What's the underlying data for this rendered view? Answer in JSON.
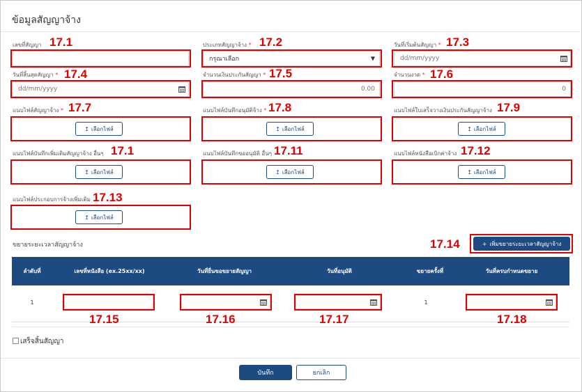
{
  "modal": {
    "title": "ข้อมูลสัญญาจ้าง",
    "required_mark": "*"
  },
  "fields": {
    "contract_no": {
      "label": "เลขที่สัญญา",
      "value": "",
      "annotation": "17.1"
    },
    "contract_type": {
      "label": "ประเภทสัญญาจ้าง",
      "selected": "กรุณาเลือก",
      "annotation": "17.2"
    },
    "start_date": {
      "label": "วันที่เริ่มต้นสัญญา",
      "placeholder": "dd/mm/yyyy",
      "annotation": "17.3"
    },
    "end_date": {
      "label": "วันที่สิ้นสุดสัญญา",
      "placeholder": "dd/mm/yyyy",
      "annotation": "17.4"
    },
    "guarantee_amount": {
      "label": "จำนวนเงินประกันสัญญา",
      "value": "0.00",
      "annotation": "17.5"
    },
    "installments": {
      "label": "จำนวนงวด",
      "value": "0",
      "annotation": "17.6"
    }
  },
  "uploads": {
    "button_label": "เลือกไฟล์",
    "items": [
      {
        "label": "แนบไฟล์สัญญาจ้าง",
        "required": true,
        "annotation": "17.7"
      },
      {
        "label": "แนบไฟล์บันทึกอนุมัติจ้าง",
        "required": true,
        "annotation": "17.8"
      },
      {
        "label": "แนบไฟล์ใบเสร็จวางเงินประกันสัญญาจ้าง",
        "required": false,
        "annotation": "17.9"
      },
      {
        "label": "แนบไฟล์บันทึกเพิ่มเติมสัญญาจ้าง อื่นๆ",
        "required": false,
        "annotation": "17.1"
      },
      {
        "label": "แนบไฟล์บันทึกขออนุมัติ อื่นๆ",
        "required": false,
        "annotation": "17.11"
      },
      {
        "label": "แนบไฟล์หนังสือเบิกค่าจ้าง",
        "required": false,
        "annotation": "17.12"
      },
      {
        "label": "แนบไฟล์ประกอบการจ้างเพิ่มเติม",
        "required": false,
        "annotation": "17.13"
      }
    ]
  },
  "extension": {
    "section_label": "ขยายระยะเวลาสัญญาจ้าง",
    "add_button": "เพิ่มขยายระยะเวลาสัญญาจ้าง",
    "add_annotation": "17.14",
    "columns": [
      "ลำดับที่",
      "เลขที่หนังสือ (ex.25xx/xx)",
      "วันที่ยื่นขอขยายสัญญา",
      "วันที่อนุมัติ",
      "ขยายครั้งที่",
      "วันที่ครบกำหนดขยาย"
    ],
    "rows": [
      {
        "seq": "1",
        "count": "1"
      }
    ],
    "cell_annotations": [
      "17.15",
      "17.16",
      "17.17",
      "17.18"
    ]
  },
  "finish": {
    "label": "เสร็จสิ้นสัญญา",
    "checked": false
  },
  "footer": {
    "save": "บันทึก",
    "cancel": "ยกเลิก"
  },
  "colors": {
    "primary": "#1e4a82",
    "annotation": "#e00000",
    "required": "#e53935"
  }
}
